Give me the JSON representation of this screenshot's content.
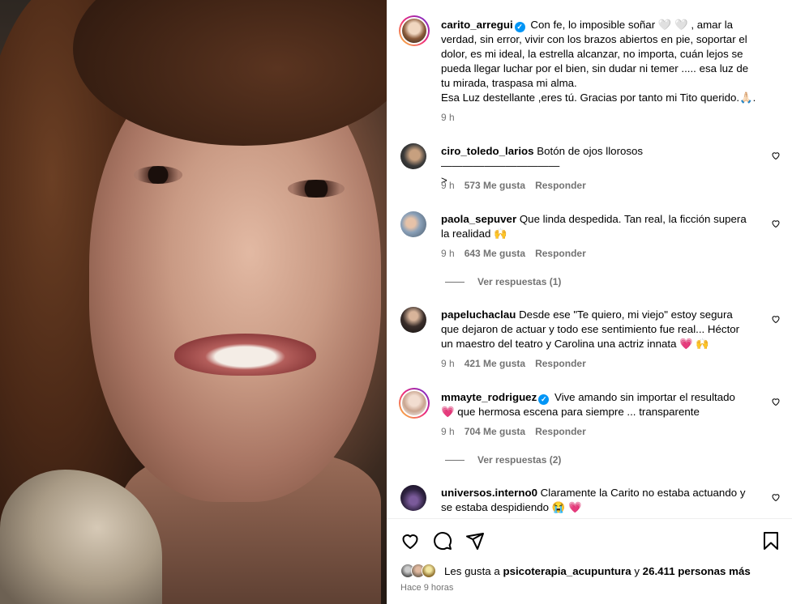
{
  "post": {
    "author": "carito_arregui",
    "caption_lines": [
      "Con fe, lo imposible soñar 🤍 🤍 , amar la",
      "verdad, sin error, vivir con los brazos abiertos en pie, soportar el",
      "dolor, es mi ideal, la estrella alcanzar, no importa, cuán lejos se",
      "pueda llegar luchar por el bien, sin dudar ni temer ..... esa luz de",
      "tu mirada, traspasa mi alma.",
      "Esa Luz destellante ,eres tú. Gracias por tanto mi Tito querido.🙏🏻."
    ],
    "time": "9 h"
  },
  "comments": [
    {
      "user": "ciro_toledo_larios",
      "text": "Botón de ojos llorosos ———————————",
      "text2": ">",
      "time": "9 h",
      "likes": "573 Me gusta",
      "reply": "Responder"
    },
    {
      "user": "paola_sepuver",
      "text": "Que linda despedida. Tan real, la ficción supera",
      "text2": "la realidad 🙌",
      "time": "9 h",
      "likes": "643 Me gusta",
      "reply": "Responder",
      "view_replies": "Ver respuestas (1)"
    },
    {
      "user": "papeluchaclau",
      "text": "Desde ese \"Te quiero, mi viejo\" estoy segura",
      "text2": "que dejaron de actuar y todo ese sentimiento fue real... Héctor",
      "text3": "un maestro del teatro y Carolina una actriz innata 💗 🙌",
      "time": "9 h",
      "likes": "421 Me gusta",
      "reply": "Responder"
    },
    {
      "user": "mmayte_rodriguez",
      "text": "Vive amando sin importar el resultado",
      "text2": "💗 que hermosa escena para siempre ... transparente",
      "time": "9 h",
      "likes": "704 Me gusta",
      "reply": "Responder",
      "view_replies": "Ver respuestas (2)"
    },
    {
      "user": "universos.interno0",
      "text": "Claramente la Carito no estaba actuando y",
      "text2": "se estaba despidiendo 😭 💗"
    }
  ],
  "footer": {
    "likes_prefix": "Les gusta a",
    "likes_user": "psicoterapia_acupuntura",
    "likes_and": "y",
    "likes_count": "26.411 personas más",
    "ago": "Hace 9 horas"
  },
  "icons": {
    "like": "heart-icon",
    "comment": "comment-icon",
    "share": "share-icon",
    "save": "bookmark-icon",
    "verified": "verified-badge-icon"
  },
  "colors": {
    "verified": "#0095f6",
    "meta": "#737373",
    "heart": "#e3345e"
  }
}
